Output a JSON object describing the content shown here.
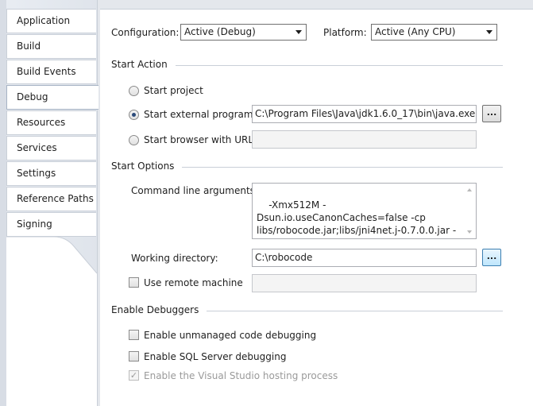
{
  "tabs": [
    {
      "label": "Application",
      "active": false
    },
    {
      "label": "Build",
      "active": false
    },
    {
      "label": "Build Events",
      "active": false
    },
    {
      "label": "Debug",
      "active": true
    },
    {
      "label": "Resources",
      "active": false
    },
    {
      "label": "Services",
      "active": false
    },
    {
      "label": "Settings",
      "active": false
    },
    {
      "label": "Reference Paths",
      "active": false
    },
    {
      "label": "Signing",
      "active": false
    }
  ],
  "config": {
    "configuration_label": "Configuration:",
    "configuration_value": "Active (Debug)",
    "platform_label": "Platform:",
    "platform_value": "Active (Any CPU)"
  },
  "start_action": {
    "title": "Start Action",
    "start_project": "Start project",
    "start_external": "Start external program:",
    "external_program_path": "C:\\Program Files\\Java\\jdk1.6.0_17\\bin\\java.exe",
    "browse_label": "...",
    "start_browser": "Start browser with URL:",
    "browser_url": "",
    "selected": "start_external"
  },
  "start_options": {
    "title": "Start Options",
    "cmd_args_label": "Command line arguments:",
    "cmd_args_value": "-Xmx512M -Dsun.io.useCanonCaches=false -cp libs/robocode.jar;libs/jni4net.j-0.7.0.0.jar -Ddebug=true robocode.Robocode",
    "working_dir_label": "Working directory:",
    "working_dir_value": "C:\\robocode",
    "browse_label": "...",
    "remote_machine_label": "Use remote machine",
    "remote_machine_value": "",
    "remote_machine_checked": false
  },
  "debuggers": {
    "title": "Enable Debuggers",
    "unmanaged": "Enable unmanaged code debugging",
    "unmanaged_checked": false,
    "sql": "Enable SQL Server debugging",
    "sql_checked": false,
    "hosting": "Enable the Visual Studio hosting process",
    "hosting_checked": true,
    "hosting_checkmark": "✓"
  }
}
